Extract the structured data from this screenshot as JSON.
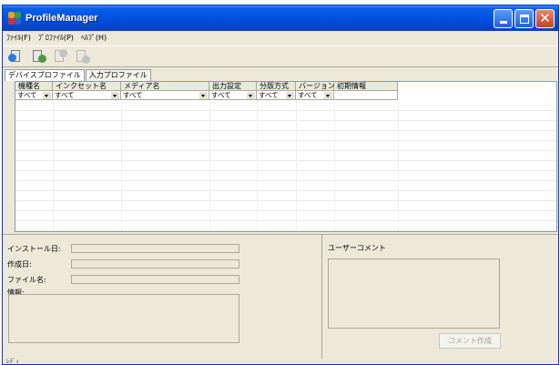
{
  "window": {
    "title": "ProfileManager"
  },
  "menu": [
    "ﾌｧｲﾙ(F)",
    "ﾌﾟﾛﾌｧｲﾙ(P)",
    "ﾍﾙﾌﾟ(H)"
  ],
  "toolbar": {
    "buttons": [
      {
        "icon": "profile-import-icon",
        "enabled": true
      },
      {
        "icon": "profile-search-icon",
        "enabled": true
      },
      {
        "icon": "profile-copy-icon",
        "enabled": false
      },
      {
        "icon": "profile-delete-icon",
        "enabled": false
      }
    ]
  },
  "tabs": [
    "デバイスプロファイル",
    "入力プロファイル"
  ],
  "grid": {
    "columns": [
      "機種名",
      "インクセット名",
      "メディア名",
      "出力設定",
      "分版方式",
      "バージョン",
      "初期情報"
    ],
    "filters": [
      "すべて",
      "すべて",
      "すべて",
      "すべて",
      "すべて",
      "すべて",
      ""
    ]
  },
  "info": {
    "install_date_label": "インストール日:",
    "created_label": "作成日:",
    "file_name_label": "ファイル名:",
    "info_label": "情報:"
  },
  "comment": {
    "label": "ユーザーコメント",
    "button": "コメント作成"
  },
  "status": "ﾚﾃﾞｨ",
  "colors": {
    "titlebar": "#0054e3",
    "window_bg": "#ece9d8",
    "grid_border": "#7f9db9",
    "close_button": "#c4421f"
  }
}
